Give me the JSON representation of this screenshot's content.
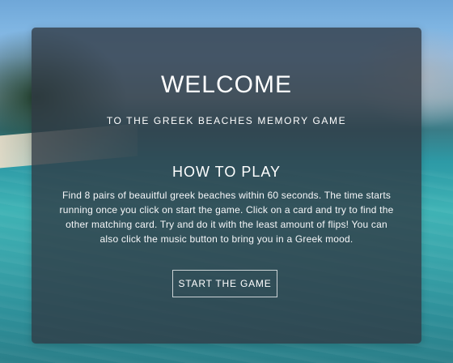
{
  "welcome": {
    "title": "WELCOME",
    "subtitle": "TO THE GREEK BEACHES MEMORY GAME"
  },
  "how_to_play": {
    "title": "HOW TO PLAY",
    "body": "Find 8 pairs of beauitful greek beaches within 60 seconds. The time starts running once you click on start the game. Click on a card and try to find the other matching card. Try and do it with the least amount of flips! You can also click the music button to bring you in a Greek mood."
  },
  "actions": {
    "start_label": "START THE GAME"
  },
  "colors": {
    "card_overlay": "#303843",
    "text": "#ffffff"
  }
}
